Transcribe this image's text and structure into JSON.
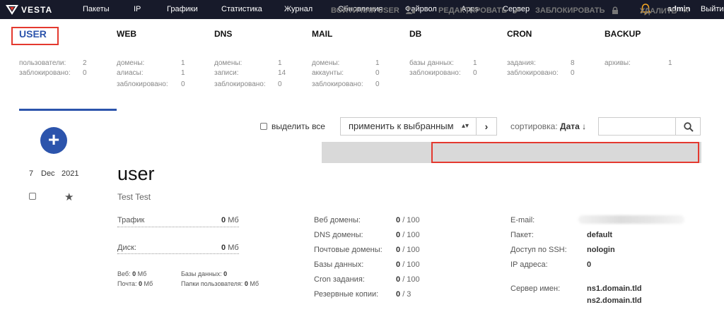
{
  "nav": {
    "logo_text": "VESTA",
    "items": [
      "Пакеты",
      "IP",
      "Графики",
      "Статистика",
      "Журнал",
      "Обновления",
      "Файрвол",
      "Apps",
      "Сервер"
    ],
    "user": "admin",
    "logout": "Выйти"
  },
  "stats": [
    {
      "title": "USER",
      "rows": [
        [
          "пользователи:",
          "2"
        ],
        [
          "заблокировано:",
          "0"
        ]
      ]
    },
    {
      "title": "WEB",
      "rows": [
        [
          "домены:",
          "1"
        ],
        [
          "алиасы:",
          "1"
        ],
        [
          "заблокировано:",
          "0"
        ]
      ]
    },
    {
      "title": "DNS",
      "rows": [
        [
          "домены:",
          "1"
        ],
        [
          "записи:",
          "14"
        ],
        [
          "заблокировано:",
          "0"
        ]
      ]
    },
    {
      "title": "MAIL",
      "rows": [
        [
          "домены:",
          "1"
        ],
        [
          "аккаунты:",
          "0"
        ],
        [
          "заблокировано:",
          "0"
        ]
      ]
    },
    {
      "title": "DB",
      "rows": [
        [
          "базы данных:",
          "1"
        ],
        [
          "заблокировано:",
          "0"
        ]
      ]
    },
    {
      "title": "CRON",
      "rows": [
        [
          "задания:",
          "8"
        ],
        [
          "заблокировано:",
          "0"
        ]
      ]
    },
    {
      "title": "BACKUP",
      "rows": [
        [
          "архивы:",
          "1"
        ]
      ]
    }
  ],
  "toolbar": {
    "add": "+",
    "select_all": "выделить все",
    "apply": "применить к выбранным",
    "go": "›",
    "sort_label": "сортировка:",
    "sort_value": "Дата ↓",
    "search_placeholder": ""
  },
  "actions": {
    "login_as": "ВОЙТИ КАК USER",
    "edit": "РЕДАКТИРОВАТЬ",
    "block": "ЗАБЛОКИРОВАТЬ",
    "delete": "УДАЛИТЬ",
    "delete_x": "×"
  },
  "record": {
    "day": "7",
    "month": "Dec",
    "year": "2021",
    "username": "user",
    "fullname": "Test Test",
    "traffic_label": "Трафик",
    "traffic_value": "0",
    "disk_label": "Диск:",
    "disk_value": "0",
    "unit_mb": "Мб",
    "web_label": "Веб:",
    "web_value": "0",
    "mail_label": "Почта:",
    "mail_value": "0",
    "db_label": "Базы данных:",
    "db_value": "0",
    "userdirs_label": "Папки пользователя:",
    "userdirs_value": "0",
    "limits": [
      {
        "label": "Веб домены:",
        "used": "0",
        "total": "/ 100"
      },
      {
        "label": "DNS домены:",
        "used": "0",
        "total": "/ 100"
      },
      {
        "label": "Почтовые домены:",
        "used": "0",
        "total": "/ 100"
      },
      {
        "label": "Базы данных:",
        "used": "0",
        "total": "/ 100"
      },
      {
        "label": "Cron задания:",
        "used": "0",
        "total": "/ 100"
      },
      {
        "label": "Резервные копии:",
        "used": "0",
        "total": "/ 3"
      }
    ],
    "email_label": "E-mail:",
    "package_label": "Пакет:",
    "package_value": "default",
    "ssh_label": "Доступ по SSH:",
    "ssh_value": "nologin",
    "ip_label": "IP адреса:",
    "ip_value": "0",
    "ns_label": "Сервер имен:",
    "ns1": "ns1.domain.tld",
    "ns2": "ns2.domain.tld"
  },
  "colors": {
    "accent": "#2c54ac",
    "highlight": "#e4392f",
    "topbar": "#171a2a",
    "bell": "#f5a623"
  }
}
